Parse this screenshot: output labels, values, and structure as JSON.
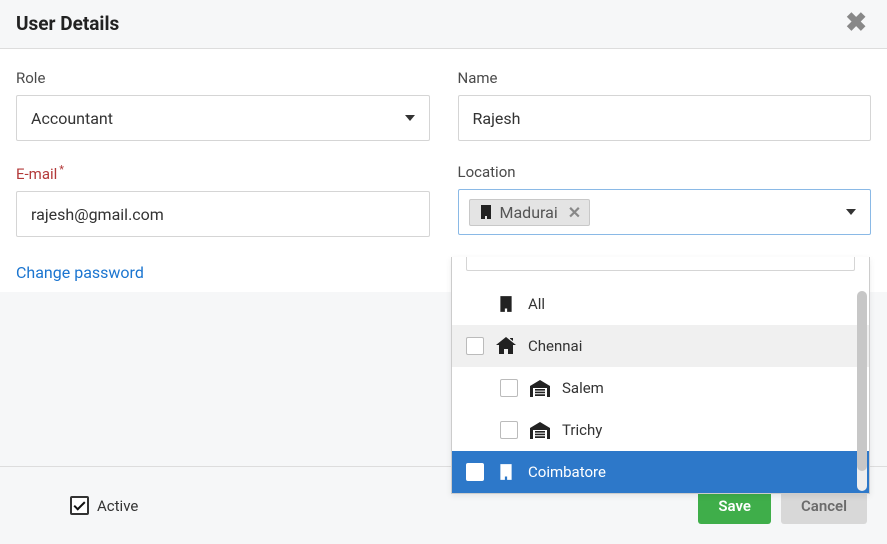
{
  "header": {
    "title": "User Details"
  },
  "form": {
    "role": {
      "label": "Role",
      "value": "Accountant"
    },
    "name": {
      "label": "Name",
      "value": "Rajesh"
    },
    "email": {
      "label": "E-mail",
      "required_mark": "*",
      "value": "rajesh@gmail.com"
    },
    "change_password": "Change password",
    "location": {
      "label": "Location",
      "selected_chip": "Madurai",
      "options": {
        "all": "All",
        "chennai": "Chennai",
        "salem": "Salem",
        "trichy": "Trichy",
        "coimbatore": "Coimbatore"
      }
    },
    "active": {
      "label": "Active",
      "checked": true
    }
  },
  "footer": {
    "save": "Save",
    "cancel": "Cancel"
  }
}
